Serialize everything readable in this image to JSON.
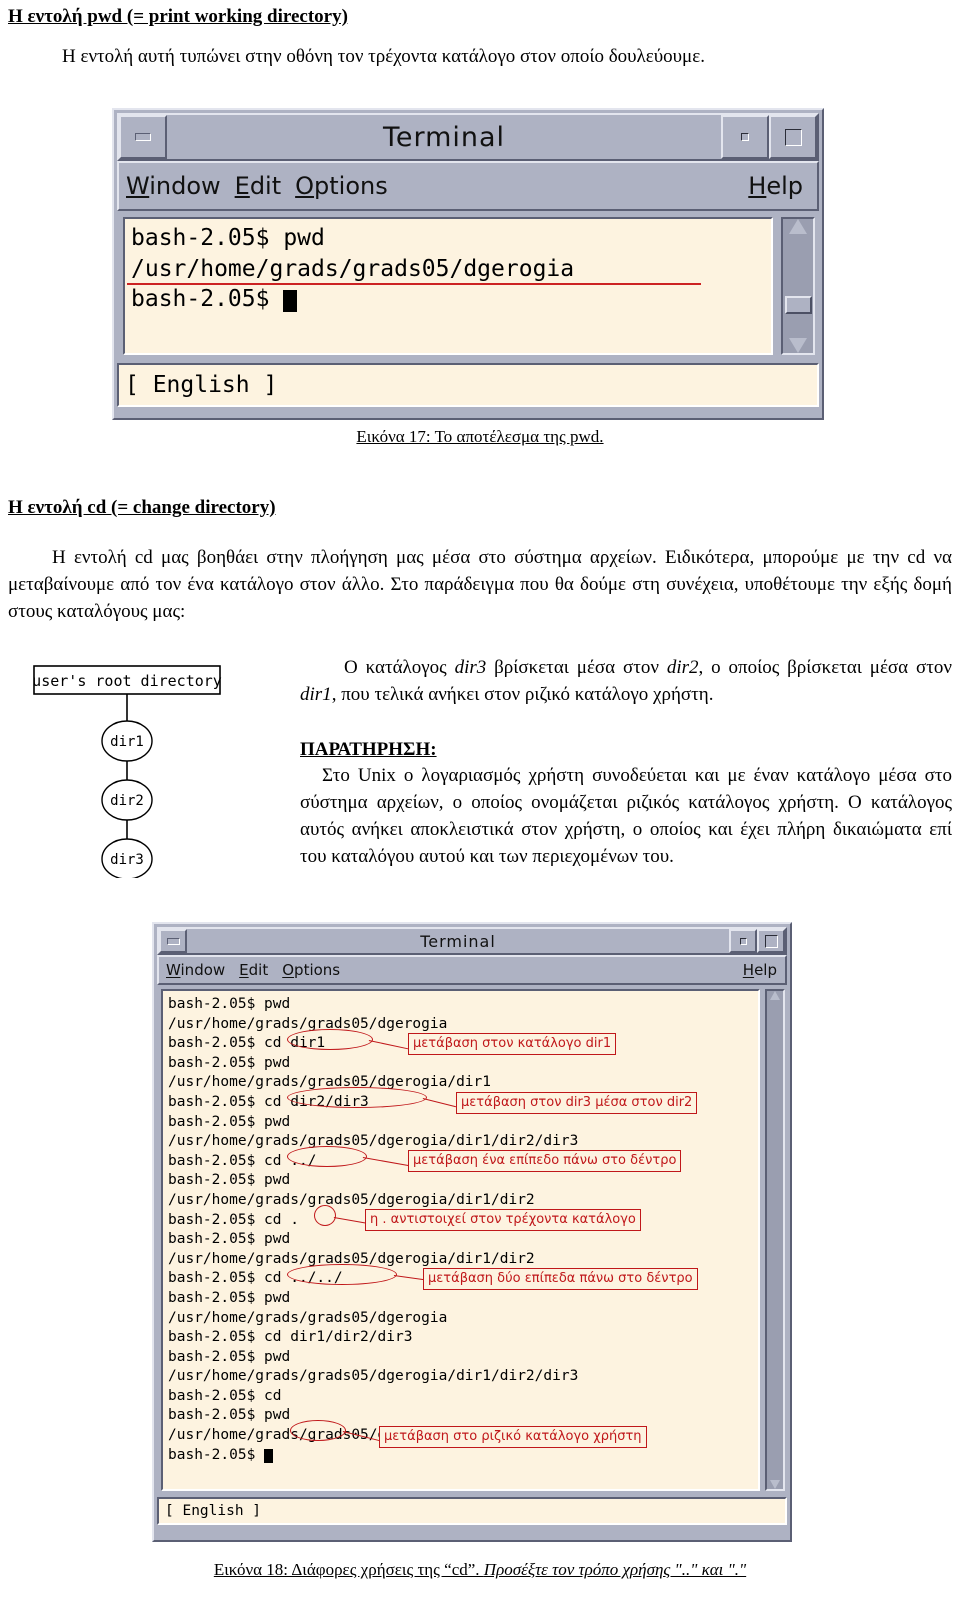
{
  "document": {
    "section_pwd": {
      "heading": "Η εντολή pwd (= print working directory)",
      "paragraph": "Η εντολή αυτή τυπώνει στην οθόνη τον τρέχοντα κατάλογο στον οποίο δουλεύουμε.",
      "caption": "Εικόνα 17: Το αποτέλεσμα της pwd."
    },
    "section_cd": {
      "heading": "Η εντολή cd (= change directory)",
      "paragraph": "Η εντολή cd μας βοηθάει στην πλοήγηση μας μέσα στο σύστημα αρχείων. Ειδικότερα, μπορούμε με την cd να μεταβαίνουμε από τον ένα κατάλογο στον άλλο. Στο παράδειγμα που θα δούμε στη συνέχεια, υποθέτουμε την εξής δομή στους καταλόγους μας:",
      "explain_1": "Ο κατάλογος ",
      "explain_dir3": "dir3",
      "explain_2": " βρίσκεται μέσα στον ",
      "explain_dir2": "dir2",
      "explain_3": ", ο οποίος βρίσκεται μέσα στον ",
      "explain_dir1": "dir1",
      "explain_4": ", που τελικά ανήκει στον ριζικό κατάλογο χρήστη.",
      "note_title": "ΠΑΡΑΤΗΡΗΣΗ:",
      "note_body": "Στο Unix ο λογαριασμός χρήστη συνοδεύεται και με έναν κατάλογο μέσα στο σύστημα αρχείων, ο οποίος ονομάζεται ριζικός κατάλογος χρήστη. Ο κατάλογος αυτός ανήκει αποκλειστικά στον χρήστη, ο οποίος και έχει πλήρη δικαιώματα επί του καταλόγου αυτού και των περιεχομένων του.",
      "caption_plain_1": "Εικόνα 18: Διάφορες χρήσεις της “cd”. ",
      "caption_italic": "Προσέξτε τον τρόπο χρήσης \"..\" και \".\""
    }
  },
  "tree": {
    "root_label": "user's root directory",
    "nodes": [
      "dir1",
      "dir2",
      "dir3"
    ]
  },
  "terminal1": {
    "title": "Terminal",
    "menu": [
      "Window",
      "Edit",
      "Options"
    ],
    "help_label": "Help",
    "status": "[ English ]",
    "lines": [
      "bash-2.05$ pwd",
      "/usr/home/grads/grads05/dgerogia",
      "bash-2.05$ "
    ],
    "colors": {
      "chrome": "#aeb2c3",
      "screen": "#fdf3e0",
      "annotation": "#c0171a"
    }
  },
  "terminal2": {
    "title": "Terminal",
    "menu": [
      "Window",
      "Edit",
      "Options"
    ],
    "help_label": "Help",
    "status": "[ English ]",
    "lines": [
      "bash-2.05$ pwd",
      "/usr/home/grads/grads05/dgerogia",
      "bash-2.05$ cd dir1",
      "bash-2.05$ pwd",
      "/usr/home/grads/grads05/dgerogia/dir1",
      "bash-2.05$ cd dir2/dir3",
      "bash-2.05$ pwd",
      "/usr/home/grads/grads05/dgerogia/dir1/dir2/dir3",
      "bash-2.05$ cd ../",
      "bash-2.05$ pwd",
      "/usr/home/grads/grads05/dgerogia/dir1/dir2",
      "bash-2.05$ cd .",
      "bash-2.05$ pwd",
      "/usr/home/grads/grads05/dgerogia/dir1/dir2",
      "bash-2.05$ cd ../../",
      "bash-2.05$ pwd",
      "/usr/home/grads/grads05/dgerogia",
      "bash-2.05$ cd dir1/dir2/dir3",
      "bash-2.05$ pwd",
      "/usr/home/grads/grads05/dgerogia/dir1/dir2/dir3",
      "bash-2.05$ cd",
      "bash-2.05$ pwd",
      "/usr/home/grads/grads05/dgerogia",
      "bash-2.05$ "
    ],
    "annotations": [
      "μετάβαση στον κατάλογο dir1",
      "μετάβαση στον dir3 μέσα στον dir2",
      "μετάβαση ένα επίπεδο πάνω στο δέντρο",
      "η . αντιστοιχεί στον τρέχοντα κατάλογο",
      "μετάβαση δύο επίπεδα πάνω στο δέντρο",
      "μετάβαση στο ριζικό κατάλογο χρήστη"
    ]
  }
}
